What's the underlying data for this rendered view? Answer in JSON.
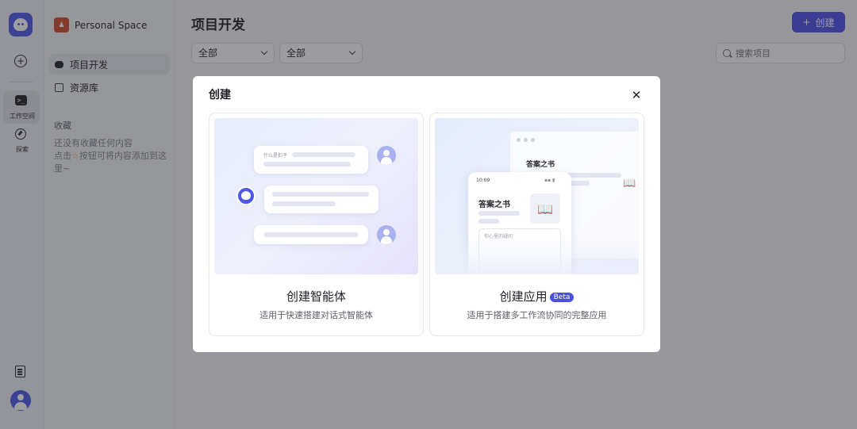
{
  "rail": {
    "workspace_label": "工作空间",
    "explore_label": "探索",
    "workspace_glyph": ">_"
  },
  "sidebar": {
    "space_name": "Personal Space",
    "nav": [
      {
        "label": "项目开发",
        "icon": "bot-icon"
      },
      {
        "label": "资源库",
        "icon": "library-icon"
      }
    ],
    "favorites_title": "收藏",
    "favorites_empty_line1": "还没有收藏任何内容",
    "favorites_empty_line2_pre": "点击",
    "favorites_empty_line2_post": "按钮可将内容添加到这里~"
  },
  "main": {
    "title": "项目开发",
    "create_label": "创建",
    "filter1": "全部",
    "filter2": "全部",
    "search_placeholder": "搜索项目"
  },
  "modal": {
    "title": "创建",
    "cards": [
      {
        "title": "创建智能体",
        "desc": "适用于快速搭建对话式智能体",
        "illus_text": "什么是扣子"
      },
      {
        "title": "创建应用",
        "badge": "Beta",
        "desc": "适用于搭建多工作流协同的完整应用",
        "window_title": "答案之书",
        "phone_time": "10:09",
        "phone_title": "答案之书",
        "phone_input": "你心里的疑问"
      }
    ]
  },
  "colors": {
    "accent": "#4b4de6",
    "logo": "#4b58e8",
    "space_badge": "#d04a2b"
  }
}
